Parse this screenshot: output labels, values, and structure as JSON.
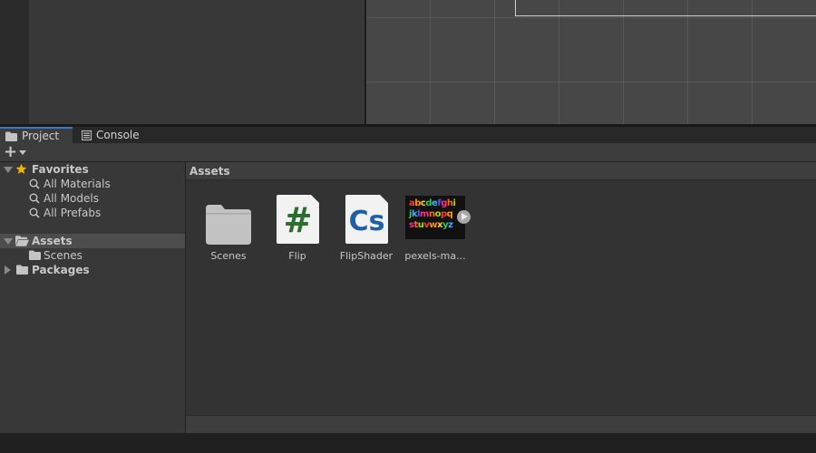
{
  "tabs": {
    "project_label": "Project",
    "console_label": "Console"
  },
  "toolbar": {
    "create_symbol": "+"
  },
  "tree": {
    "favorites": {
      "label": "Favorites",
      "items": [
        "All Materials",
        "All Models",
        "All Prefabs"
      ]
    },
    "assets": {
      "label": "Assets",
      "children": [
        "Scenes"
      ]
    },
    "packages": {
      "label": "Packages"
    }
  },
  "assets_panel": {
    "header": "Assets",
    "items": [
      {
        "name": "Scenes",
        "kind": "folder"
      },
      {
        "name": "Flip",
        "kind": "script",
        "glyph": "#",
        "glyph_color": "#2c6e2f"
      },
      {
        "name": "FlipShader",
        "kind": "script",
        "glyph": "Cs",
        "glyph_color": "#1f5fa6"
      },
      {
        "name": "pexels-ma...",
        "kind": "texture",
        "image_lines": [
          "abcdefghi",
          "jklmnopq",
          "stuvwxyz"
        ]
      }
    ]
  },
  "colors": {
    "accent_tab": "#3a79bb",
    "favorite_star": "#f0b400",
    "folder": "#c2c2c2"
  }
}
